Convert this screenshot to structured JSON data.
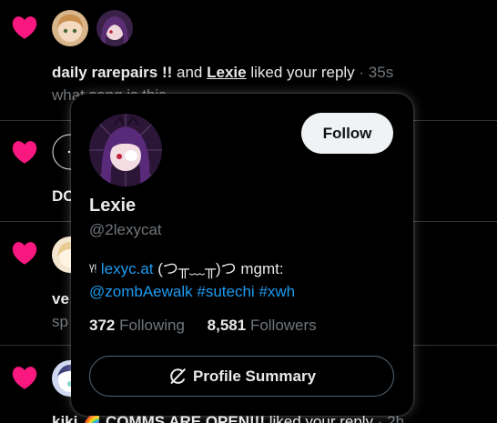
{
  "notifications": [
    {
      "icon": "heart-icon",
      "actor1": "daily rarepairs !!",
      "joiner": "and",
      "actor2": "Lexie",
      "action": "liked your reply",
      "time": "· 35s",
      "preview": "what song is this"
    },
    {
      "icon": "heart-icon",
      "partial": "DC"
    },
    {
      "icon": "heart-icon",
      "partial": "ve",
      "preview_partial": "sp"
    },
    {
      "icon": "heart-icon",
      "actor1": "kiki 🌈 COMMS ARE OPEN!!!",
      "action": "liked your reply",
      "time": "· 2h"
    }
  ],
  "hover_card": {
    "display_name": "Lexie",
    "handle": "@2lexycat",
    "follow_label": "Follow",
    "bio_prefix": "ᵞᵎ",
    "bio_link": "lexyc.at",
    "bio_middle": "(つ╥﹏╥)つ mgmt:",
    "bio_mention": "@zombAewalk",
    "bio_tags": [
      "#sutechi",
      "#xwh"
    ],
    "following_count": "372",
    "following_label": "Following",
    "followers_count": "8,581",
    "followers_label": "Followers",
    "summary_label": "Profile Summary",
    "summary_icon": "grok-icon"
  },
  "colors": {
    "background": "#000000",
    "heart": "#f91880",
    "link": "#1d9bf0",
    "muted": "#71767b",
    "text": "#e7e9ea"
  }
}
